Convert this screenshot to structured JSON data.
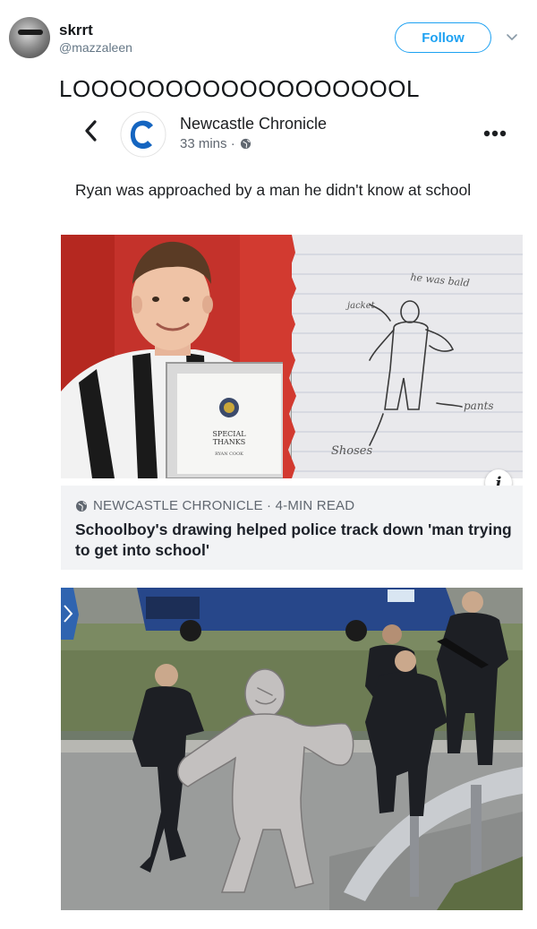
{
  "tweet": {
    "display_name": "skrrt",
    "handle": "@mazzaleen",
    "follow_label": "Follow",
    "text": "LOOOOOOOOOOOOOOOOOOL"
  },
  "embed": {
    "publisher": "Newcastle Chronicle",
    "meta": "33 mins ·",
    "post_text": "Ryan was approached by a man he didn't know at school",
    "certificate": {
      "line1": "SPECIAL",
      "line2": "THANKS",
      "line3": "RYAN COOK"
    },
    "drawing_labels": {
      "top": "he was bald",
      "jacket": "jacket",
      "pants": "pants",
      "shoes": "Shoses"
    },
    "info_glyph": "i",
    "source": "NEWCASTLE CHRONICLE · 4-MIN READ",
    "headline": "Schoolboy's drawing helped police track down 'man trying to get into school'"
  },
  "colors": {
    "follow_blue": "#1da1f2",
    "logo_blue": "#1565c0",
    "caption_bg": "#f2f3f5"
  },
  "icons": [
    "avatar",
    "chevron-down-icon",
    "back-chevron-icon",
    "newspaper-logo-icon",
    "globe-icon",
    "more-dots-icon",
    "info-icon"
  ]
}
